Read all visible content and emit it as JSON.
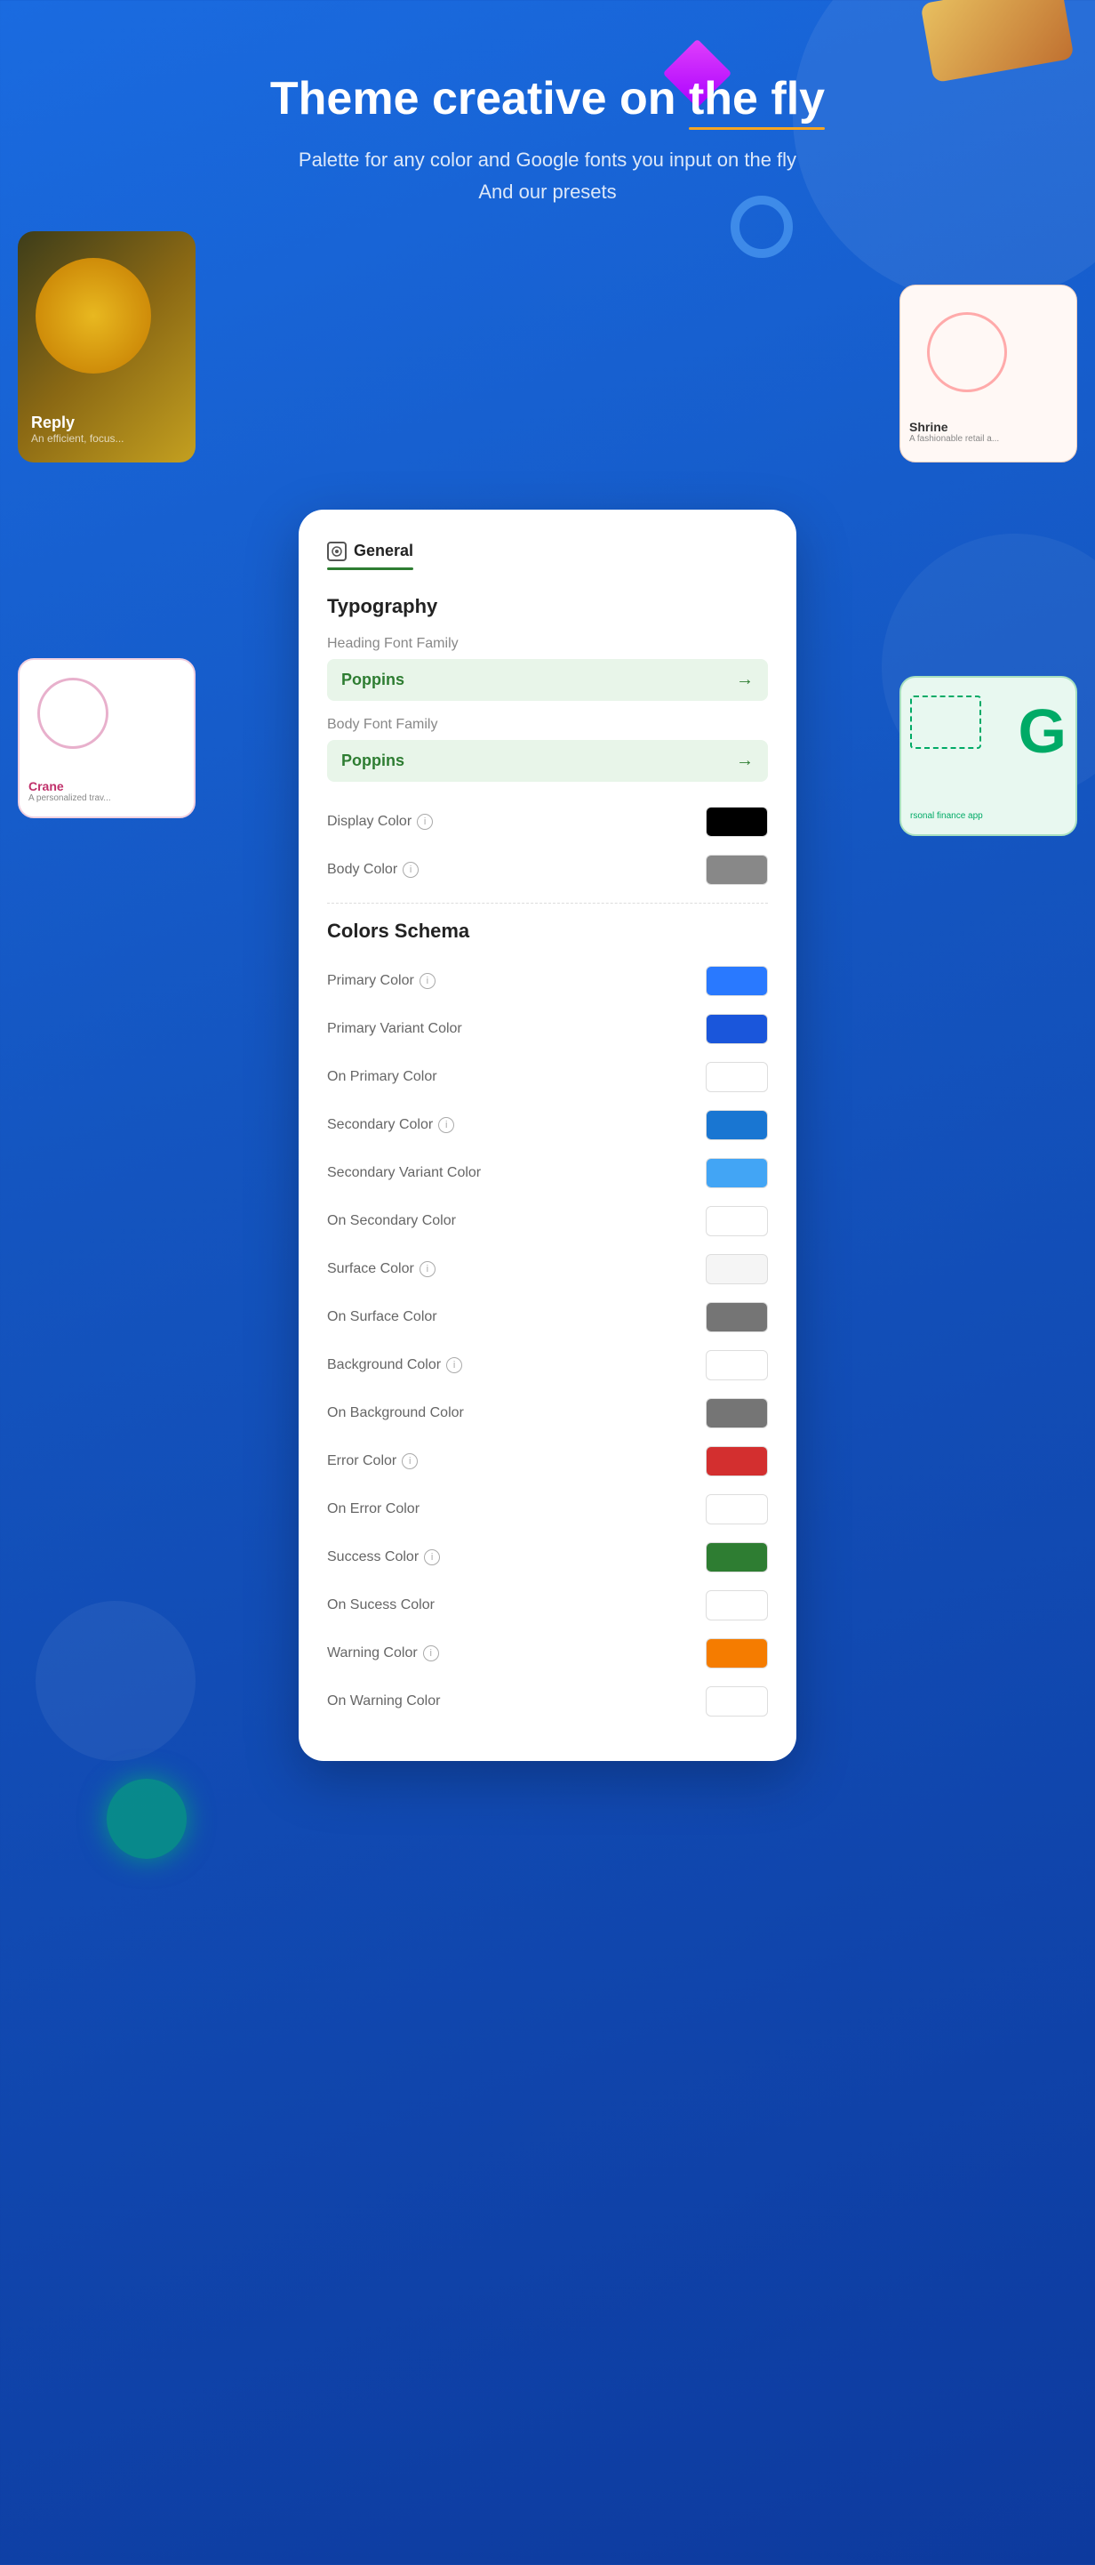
{
  "header": {
    "title_part1": "Theme creative on ",
    "title_highlight": "the fly",
    "subtitle_line1": "Palette for any color and Google fonts you input on the fly",
    "subtitle_line2": "And our presets"
  },
  "tab": {
    "icon": "⚙",
    "label": "General",
    "underline_color": "#2e7d32"
  },
  "typography": {
    "section_title": "Typography",
    "heading_font_family_label": "Heading Font Family",
    "heading_font_value": "Poppins",
    "body_font_family_label": "Body Font Family",
    "body_font_value": "Poppins",
    "display_color_label": "Display Color",
    "display_color_value": "#000000",
    "body_color_label": "Body Color",
    "body_color_value": "#888888"
  },
  "colors_schema": {
    "section_title": "Colors Schema",
    "colors": [
      {
        "label": "Primary Color",
        "has_info": true,
        "value": "#2979ff"
      },
      {
        "label": "Primary Variant Color",
        "has_info": false,
        "value": "#1a56db"
      },
      {
        "label": "On Primary Color",
        "has_info": false,
        "value": "#ffffff"
      },
      {
        "label": "Secondary Color",
        "has_info": true,
        "value": "#1976d2"
      },
      {
        "label": "Secondary Variant Color",
        "has_info": false,
        "value": "#42a5f5"
      },
      {
        "label": "On Secondary Color",
        "has_info": false,
        "value": "#ffffff"
      },
      {
        "label": "Surface Color",
        "has_info": true,
        "value": "#f5f5f5"
      },
      {
        "label": "On Surface Color",
        "has_info": false,
        "value": "#757575"
      },
      {
        "label": "Background Color",
        "has_info": true,
        "value": "#ffffff"
      },
      {
        "label": "On Background Color",
        "has_info": false,
        "value": "#757575"
      },
      {
        "label": "Error Color",
        "has_info": true,
        "value": "#d32f2f"
      },
      {
        "label": "On Error Color",
        "has_info": false,
        "value": "#ffffff"
      },
      {
        "label": "Success Color",
        "has_info": true,
        "value": "#2e7d32"
      },
      {
        "label": "On Sucess Color",
        "has_info": false,
        "value": "#ffffff"
      },
      {
        "label": "Warning Color",
        "has_info": true,
        "value": "#f57c00"
      },
      {
        "label": "On Warning Color",
        "has_info": false,
        "value": "#ffffff"
      }
    ]
  },
  "bg_cards": {
    "reply_title": "Reply",
    "reply_sub": "An efficient, focus...",
    "shrine_title": "Shrine",
    "shrine_sub": "A fashionable retail a...",
    "crane_title": "Crane",
    "crane_sub": "A personalized trav...",
    "finance_sub": "rsonal finance app"
  }
}
